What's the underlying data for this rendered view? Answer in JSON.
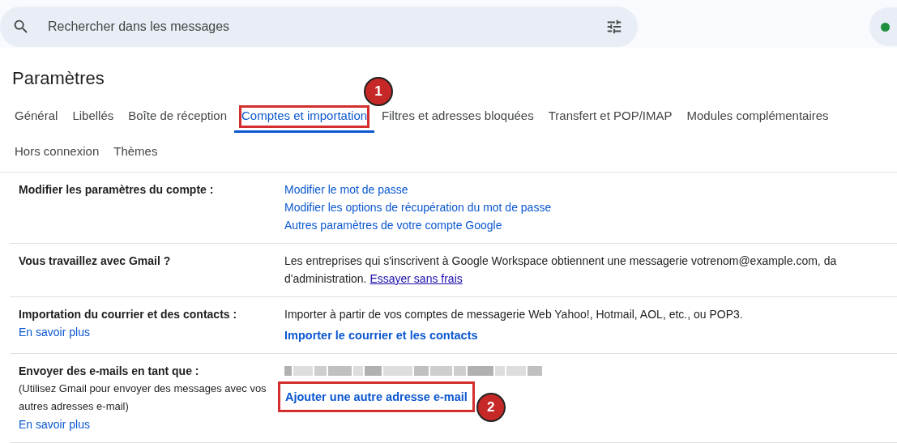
{
  "search": {
    "placeholder": "Rechercher dans les messages"
  },
  "title": "Paramètres",
  "tab_rows": [
    [
      {
        "label": "Général",
        "selected": false
      },
      {
        "label": "Libellés",
        "selected": false
      },
      {
        "label": "Boîte de réception",
        "selected": false
      },
      {
        "label": "Comptes et importation",
        "selected": true,
        "callout": "1"
      },
      {
        "label": "Filtres et adresses bloquées",
        "selected": false
      },
      {
        "label": "Transfert et POP/IMAP",
        "selected": false
      },
      {
        "label": "Modules complémentaires",
        "selected": false
      }
    ],
    [
      {
        "label": "Hors connexion",
        "selected": false
      },
      {
        "label": "Thèmes",
        "selected": false
      }
    ]
  ],
  "sections": [
    {
      "label": "Modifier les paramètres du compte :",
      "items": [
        {
          "kind": "link",
          "text": "Modifier le mot de passe"
        },
        {
          "kind": "link",
          "text": "Modifier les options de récupération du mot de passe"
        },
        {
          "kind": "link",
          "text": "Autres paramètres de votre compte Google"
        }
      ]
    },
    {
      "label": "Vous travaillez avec Gmail ?",
      "items": [
        {
          "kind": "paragraph",
          "lines": [
            "Les entreprises qui s'inscrivent à Google Workspace obtiennent une messagerie votrenom@example.com, da",
            "d'administration."
          ],
          "link": "Essayer sans frais"
        }
      ]
    },
    {
      "label": "Importation du courrier et des contacts :",
      "learn_more": "En savoir plus",
      "items": [
        {
          "kind": "text",
          "text": "Importer à partir de vos comptes de messagerie Web Yahoo!, Hotmail, AOL, etc., ou POP3."
        },
        {
          "kind": "strong_link",
          "text": "Importer le courrier et les contacts"
        }
      ]
    },
    {
      "label": "Envoyer des e-mails en tant que :",
      "note": "(Utilisez Gmail pour envoyer des messages avec vos autres adresses e-mail)",
      "learn_more": "En savoir plus",
      "items": [
        {
          "kind": "redacted"
        },
        {
          "kind": "strong_link",
          "text": "Ajouter une autre adresse e-mail",
          "callout": "2"
        }
      ]
    }
  ]
}
